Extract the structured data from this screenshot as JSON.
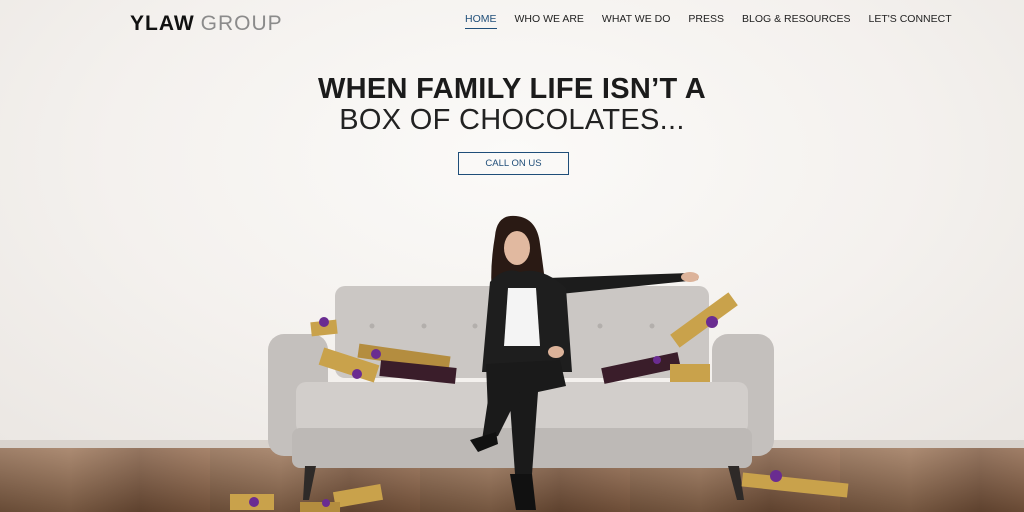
{
  "header": {
    "logo_bold": "YLAW",
    "logo_light": "GROUP",
    "nav": [
      {
        "label": "HOME",
        "active": true
      },
      {
        "label": "WHO WE ARE",
        "active": false
      },
      {
        "label": "WHAT WE DO",
        "active": false
      },
      {
        "label": "PRESS",
        "active": false
      },
      {
        "label": "BLOG & RESOURCES",
        "active": false
      },
      {
        "label": "LET'S CONNECT",
        "active": false
      }
    ]
  },
  "hero": {
    "headline": "WHEN FAMILY LIFE ISN’T A",
    "subheadline": "BOX OF CHOCOLATES...",
    "cta_label": "CALL ON US"
  },
  "colors": {
    "accent": "#1f4e79",
    "text": "#1b1b1b",
    "sofa": "#c9c5c2",
    "ribbon": "#6a2c91",
    "box_gold": "#c9a24b"
  }
}
